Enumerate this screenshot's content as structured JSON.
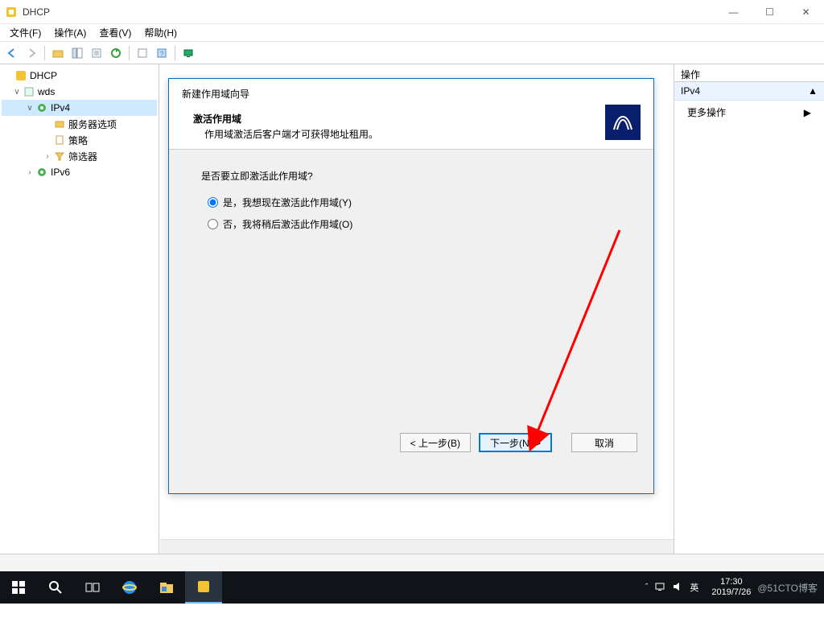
{
  "window": {
    "title": "DHCP",
    "controls": {
      "min": "—",
      "max": "☐",
      "close": "✕"
    }
  },
  "menubar": {
    "file": "文件(F)",
    "action": "操作(A)",
    "view": "查看(V)",
    "help": "帮助(H)"
  },
  "tree": {
    "root": "DHCP",
    "server": "wds",
    "ipv4": "IPv4",
    "server_options": "服务器选项",
    "policies": "策略",
    "filters": "筛选器",
    "ipv6": "IPv6"
  },
  "actions": {
    "header": "操作",
    "sub": "IPv4",
    "more": "更多操作"
  },
  "wizard": {
    "title": "新建作用域向导",
    "section_title": "激活作用域",
    "section_desc": "作用域激活后客户端才可获得地址租用。",
    "question": "是否要立即激活此作用域?",
    "opt_yes": "是，我想现在激活此作用域(Y)",
    "opt_no": "否，我将稍后激活此作用域(O)",
    "back": "< 上一步(B)",
    "next": "下一步(N) >",
    "cancel": "取消"
  },
  "taskbar": {
    "ime": "英",
    "time": "17:30",
    "date": "2019/7/26",
    "watermark": "@51CTO博客"
  }
}
